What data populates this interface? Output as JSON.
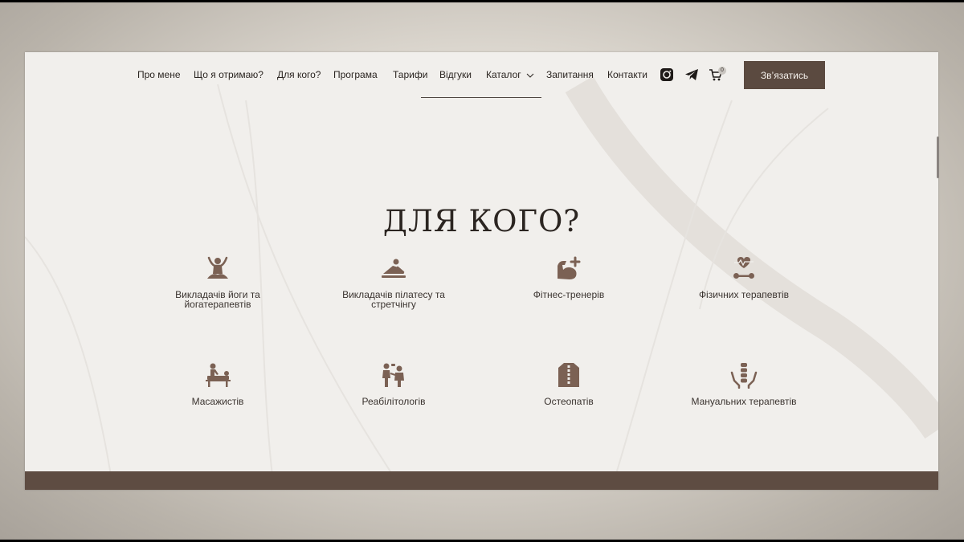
{
  "nav": {
    "items": [
      {
        "label": "Про мене"
      },
      {
        "label": "Що я отримаю?"
      },
      {
        "label": "Для кого?"
      },
      {
        "label": "Програма"
      },
      {
        "label": "Тарифи"
      },
      {
        "label": "Відгуки"
      },
      {
        "label": "Каталог"
      },
      {
        "label": "Запитання"
      },
      {
        "label": "Контакти"
      }
    ],
    "cart_count": "0",
    "cta_label": "Зв’язатись",
    "icons": [
      "instagram-icon",
      "telegram-icon",
      "cart-icon"
    ]
  },
  "section": {
    "title": "ДЛЯ КОГО?",
    "audiences": [
      {
        "label": "Викладачів йоги та йогатерапевтів",
        "icon": "yoga-meditation-icon"
      },
      {
        "label": "Викладачів пілатесу та стретчінгу",
        "icon": "stretching-icon"
      },
      {
        "label": "Фітнес-тренерів",
        "icon": "flexed-bicep-icon"
      },
      {
        "label": "Фізичних терапевтів",
        "icon": "heartbeat-dumbbell-icon"
      },
      {
        "label": "Масажистів",
        "icon": "massage-table-icon"
      },
      {
        "label": "Реабілітологів",
        "icon": "rehabilitation-icon"
      },
      {
        "label": "Остеопатів",
        "icon": "spine-back-icon"
      },
      {
        "label": "Мануальних терапевтів",
        "icon": "spine-hands-icon"
      }
    ]
  },
  "colors": {
    "accent": "#5b4a40",
    "icon": "#7b6154",
    "text": "#2b2521",
    "page_bg": "#f1efec"
  }
}
